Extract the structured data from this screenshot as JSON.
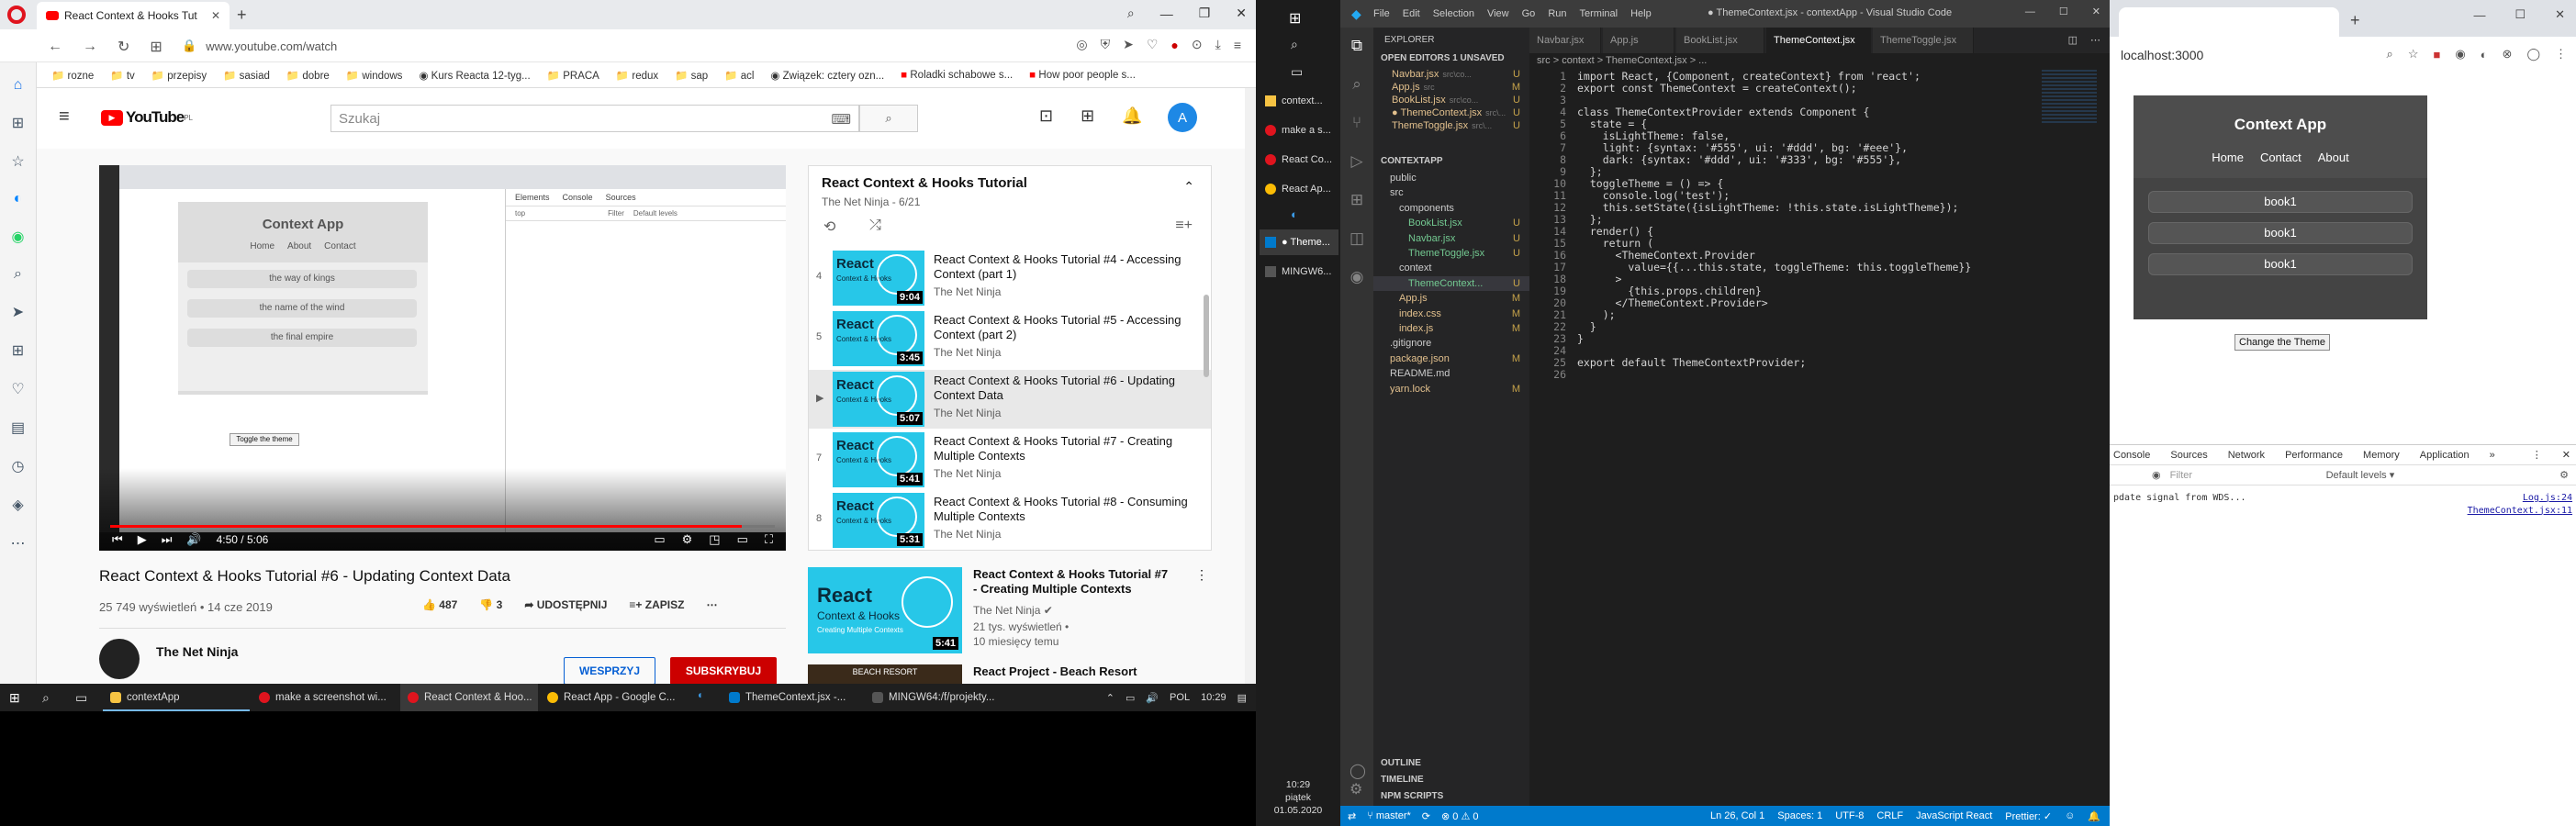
{
  "opera": {
    "tab_title": "React Context & Hooks Tut",
    "url": "www.youtube.com/watch",
    "bookmarks": [
      "rozne",
      "tv",
      "przepisy",
      "sasiad",
      "dobre",
      "windows",
      "Kurs Reacta 12-tyg...",
      "PRACA",
      "redux",
      "sap",
      "acl",
      "Związek: cztery ozn...",
      "Roladki schabowe s...",
      "How poor people s..."
    ]
  },
  "youtube": {
    "search_placeholder": "Szukaj",
    "avatar_letter": "A",
    "logo_text": "YouTube",
    "logo_region": "PL",
    "player": {
      "inner_title": "Context App",
      "inner_nav": [
        "Home",
        "About",
        "Contact"
      ],
      "inner_books": [
        "the way of kings",
        "the name of the wind",
        "the final empire"
      ],
      "inner_button": "Toggle the theme",
      "devtools_tabs": [
        "Elements",
        "Console",
        "Sources"
      ],
      "devtools_filter": "Filter",
      "devtools_levels": "Default levels",
      "devtools_top": "top",
      "time": "4:50 / 5:06",
      "progress": 0.95
    },
    "video": {
      "title": "React Context & Hooks Tutorial #6 - Updating Context Data",
      "views": "25 749 wyświetleń • 14 cze 2019",
      "likes": "487",
      "dislikes": "3",
      "share": "UDOSTĘPNIJ",
      "save": "ZAPISZ",
      "channel": "The Net Ninja",
      "support": "WESPRZYJ",
      "subscribe": "SUBSKRYBUJ"
    },
    "playlist": {
      "title": "React Context & Hooks Tutorial",
      "sub": "The Net Ninja - 6/21",
      "items": [
        {
          "num": "4",
          "title": "React Context & Hooks Tutorial #4 - Accessing Context (part 1)",
          "channel": "The Net Ninja",
          "dur": "9:04"
        },
        {
          "num": "5",
          "title": "React Context & Hooks Tutorial #5 - Accessing Context (part 2)",
          "channel": "The Net Ninja",
          "dur": "3:45"
        },
        {
          "num": "▶",
          "title": "React Context & Hooks Tutorial #6 - Updating Context Data",
          "channel": "The Net Ninja",
          "dur": "5:07"
        },
        {
          "num": "7",
          "title": "React Context & Hooks Tutorial #7 - Creating Multiple Contexts",
          "channel": "The Net Ninja",
          "dur": "5:41"
        },
        {
          "num": "8",
          "title": "React Context & Hooks Tutorial #8 - Consuming Multiple Contexts",
          "channel": "The Net Ninja",
          "dur": "5:31"
        }
      ]
    },
    "recommended": {
      "title": "React Context & Hooks Tutorial #7 - Creating Multiple Contexts",
      "channel": "The Net Ninja",
      "views": "21 tys. wyświetleń •",
      "ago": "10 miesięcy temu",
      "dur": "5:41",
      "thumb_title": "React",
      "thumb_sub": "Context & Hooks",
      "thumb_caption": "Creating Multiple Contexts",
      "next_title": "React Project - Beach Resort",
      "next_thumb": "BEACH RESORT"
    }
  },
  "taskbar": {
    "apps": [
      "contextApp",
      "make a screenshot wi...",
      "React Context & Hoo...",
      "React App - Google C...",
      "ThemeContext.jsx -...",
      "MINGW64:/f/projekty..."
    ],
    "lang": "POL",
    "time": "10:29"
  },
  "left_tb": {
    "items": [
      "context...",
      "make a s...",
      "React Co...",
      "React Ap...",
      "● Theme...",
      "MINGW6..."
    ],
    "time": "10:29",
    "day": "piątek",
    "date": "01.05.2020"
  },
  "vscode": {
    "title": "● ThemeContext.jsx - contextApp - Visual Studio Code",
    "menu": [
      "File",
      "Edit",
      "Selection",
      "View",
      "Go",
      "Run",
      "Terminal",
      "Help"
    ],
    "explorer": "EXPLORER",
    "open_editors": "OPEN EDITORS   1 UNSAVED",
    "open_files": [
      {
        "name": "Navbar.jsx",
        "path": "src\\co...",
        "mark": "U"
      },
      {
        "name": "App.js",
        "path": "src",
        "mark": "M"
      },
      {
        "name": "BookList.jsx",
        "path": "src\\co...",
        "mark": "U"
      },
      {
        "name": "● ThemeContext.jsx",
        "path": "src\\...",
        "mark": "U"
      },
      {
        "name": "ThemeToggle.jsx",
        "path": "src\\...",
        "mark": "U"
      }
    ],
    "project": "CONTEXTAPP",
    "tree": [
      {
        "name": "public",
        "depth": 1,
        "mark": ""
      },
      {
        "name": "src",
        "depth": 1,
        "mark": ""
      },
      {
        "name": "components",
        "depth": 2,
        "mark": ""
      },
      {
        "name": "BookList.jsx",
        "depth": 3,
        "mark": "U"
      },
      {
        "name": "Navbar.jsx",
        "depth": 3,
        "mark": "U"
      },
      {
        "name": "ThemeToggle.jsx",
        "depth": 3,
        "mark": "U"
      },
      {
        "name": "context",
        "depth": 2,
        "mark": ""
      },
      {
        "name": "ThemeContext...",
        "depth": 3,
        "mark": "U"
      },
      {
        "name": "App.js",
        "depth": 2,
        "mark": "M"
      },
      {
        "name": "index.css",
        "depth": 2,
        "mark": "M"
      },
      {
        "name": "index.js",
        "depth": 2,
        "mark": "M"
      },
      {
        "name": ".gitignore",
        "depth": 1,
        "mark": ""
      },
      {
        "name": "package.json",
        "depth": 1,
        "mark": "M"
      },
      {
        "name": "README.md",
        "depth": 1,
        "mark": ""
      },
      {
        "name": "yarn.lock",
        "depth": 1,
        "mark": "M"
      }
    ],
    "outline": "OUTLINE",
    "timeline": "TIMELINE",
    "npm": "NPM SCRIPTS",
    "tabs": [
      "Navbar.jsx",
      "App.js",
      "BookList.jsx",
      "ThemeContext.jsx",
      "ThemeToggle.jsx"
    ],
    "breadcrumb": "src > context > ThemeContext.jsx > ...",
    "code": [
      "import React, {Component, createContext} from 'react';",
      "export const ThemeContext = createContext();",
      "",
      "class ThemeContextProvider extends Component {",
      "  state = {",
      "    isLightTheme: false,",
      "    light: {syntax: '#555', ui: '#ddd', bg: '#eee'},",
      "    dark: {syntax: '#ddd', ui: '#333', bg: '#555'},",
      "  };",
      "  toggleTheme = () => {",
      "    console.log('test');",
      "    this.setState({isLightTheme: !this.state.isLightTheme});",
      "  };",
      "  render() {",
      "    return (",
      "      <ThemeContext.Provider",
      "        value={{...this.state, toggleTheme: this.toggleTheme}}",
      "      >",
      "        {this.props.children}",
      "      </ThemeContext.Provider>",
      "    );",
      "  }",
      "}",
      "",
      "export default ThemeContextProvider;",
      ""
    ],
    "status": {
      "branch": "master*",
      "problems": "⊗ 0 ⚠ 0",
      "position": "Ln 26, Col 1",
      "spaces": "Spaces: 1",
      "encoding": "UTF-8",
      "eol": "CRLF",
      "lang": "JavaScript React",
      "prettier": "Prettier: ✓"
    }
  },
  "chrome": {
    "url": "localhost:3000",
    "app": {
      "title": "Context App",
      "nav": [
        "Home",
        "Contact",
        "About"
      ],
      "books": [
        "book1",
        "book1",
        "book1"
      ],
      "button": "Change the Theme"
    },
    "devtools": {
      "tabs": [
        "Console",
        "Sources",
        "Network",
        "Performance",
        "Memory",
        "Application"
      ],
      "filter": "Filter",
      "levels": "Default levels ▾",
      "log1": "pdate signal from WDS...",
      "log1_src": "Log.js:24",
      "log2_src": "ThemeContext.jsx:11"
    }
  }
}
